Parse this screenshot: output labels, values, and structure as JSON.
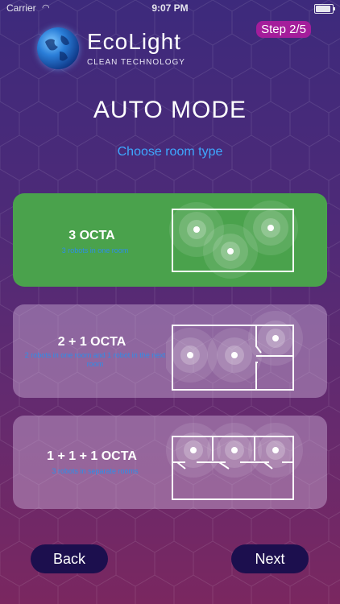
{
  "status_bar": {
    "carrier": "Carrier",
    "time": "9:07 PM"
  },
  "header": {
    "brand": "EcoLight",
    "tagline": "CLEAN TECHNOLOGY",
    "step": "Step 2/5"
  },
  "screen": {
    "title": "AUTO MODE",
    "subtitle": "Choose room type"
  },
  "options": [
    {
      "title": "3 OCTA",
      "description": "3 robots in one room",
      "selected": true
    },
    {
      "title": "2 + 1 OCTA",
      "description": "2 robots in one room and 1 robot in the next room",
      "selected": false
    },
    {
      "title": "1 + 1 + 1 OCTA",
      "description": "3 robots in separate rooms",
      "selected": false
    }
  ],
  "buttons": {
    "back": "Back",
    "next": "Next"
  },
  "colors": {
    "selected_card": "#4aa24c",
    "accent_blue": "#3ea8ff",
    "button_bg": "#1c0f4e",
    "step_badge": "#a41d9b"
  }
}
